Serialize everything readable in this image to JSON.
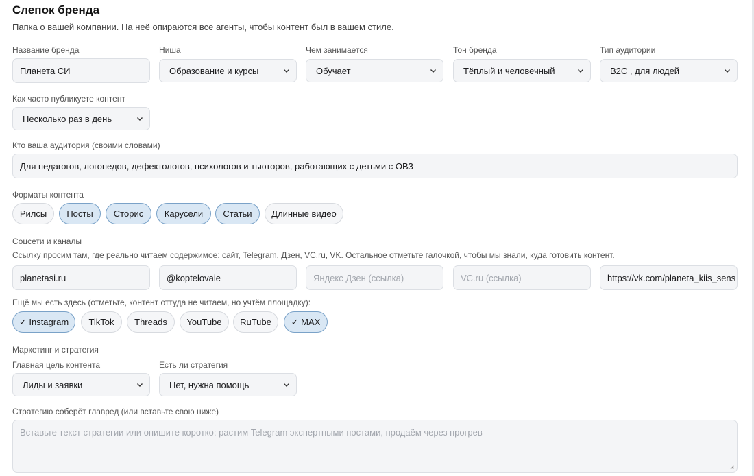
{
  "header": {
    "title": "Слепок бренда",
    "subtitle": "Папка о вашей компании. На неё опираются все агенты, чтобы контент был в вашем стиле."
  },
  "brand": {
    "name_label": "Название бренда",
    "name_value": "Планета СИ",
    "niche_label": "Ниша",
    "niche_value": "Образование и курсы",
    "activity_label": "Чем занимается",
    "activity_value": "Обучает",
    "tone_label": "Тон бренда",
    "tone_value": "Тёплый и человечный",
    "audience_type_label": "Тип аудитории",
    "audience_type_value": "B2C , для людей",
    "frequency_label": "Как часто публикуете контент",
    "frequency_value": "Несколько раз в день",
    "audience_label": "Кто ваша аудитория (своими словами)",
    "audience_value": "Для педагогов, логопедов, дефектологов, психологов и тьюторов, работающих с детьми с ОВЗ"
  },
  "formats": {
    "label": "Форматы контента",
    "items": [
      {
        "label": "Рилсы",
        "selected": false
      },
      {
        "label": "Посты",
        "selected": true
      },
      {
        "label": "Сторис",
        "selected": true
      },
      {
        "label": "Карусели",
        "selected": true
      },
      {
        "label": "Статьи",
        "selected": true
      },
      {
        "label": "Длинные видео",
        "selected": false
      }
    ]
  },
  "socials": {
    "label": "Соцсети и каналы",
    "hint": "Ссылку просим там, где реально читаем содержимое: сайт, Telegram, Дзен, VC.ru, VK. Остальное отметьте галочкой, чтобы мы знали, куда готовить контент.",
    "site_value": "planetasi.ru",
    "telegram_value": "@koptelovaie",
    "dzen_placeholder": "Яндекс Дзен (ссылка)",
    "vc_placeholder": "VC.ru (ссылка)",
    "vk_value": "https://vk.com/planeta_kiis_sens",
    "extra_label": "Ещё мы есть здесь (отметьте, контент оттуда не читаем, но учтём площадку):",
    "platforms": [
      {
        "label": "✓ Instagram",
        "selected": true
      },
      {
        "label": "TikTok",
        "selected": false
      },
      {
        "label": "Threads",
        "selected": false
      },
      {
        "label": "YouTube",
        "selected": false
      },
      {
        "label": "RuTube",
        "selected": false
      },
      {
        "label": "✓ MAX",
        "selected": true
      }
    ]
  },
  "marketing": {
    "section_label": "Маркетинг и стратегия",
    "goal_label": "Главная цель контента",
    "goal_value": "Лиды и заявки",
    "strategy_label": "Есть ли стратегия",
    "strategy_value": "Нет, нужна помощь",
    "strategy_text_label": "Стратегию соберёт главред (или вставьте свою ниже)",
    "strategy_placeholder": "Вставьте текст стратегии или опишите коротко: растим Telegram экспертными постами, продаём через прогрев"
  },
  "icons": {
    "select_arrow": "chevron-down-icon",
    "resize": "resize-grip-icon"
  },
  "colors": {
    "chip_selected_bg": "#d9e7f4",
    "chip_selected_border": "#7aa2c8",
    "field_bg": "#f4f5f7"
  }
}
